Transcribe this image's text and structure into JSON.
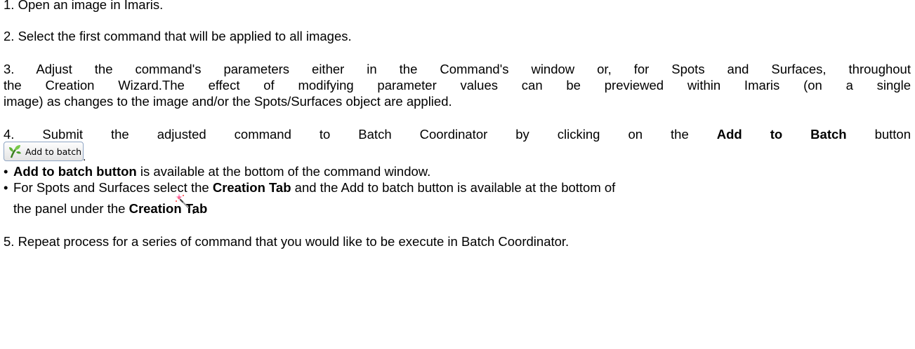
{
  "steps": {
    "s1": "1. Open an image in Imaris.",
    "s2": "2. Select the first command that will be applied to all images.",
    "s3_l1": "3. Adjust the command's parameters either in the Command's window or, for Spots and Surfaces, throughout",
    "s3_l2": "the Creation Wizard.The effect of modifying parameter values can be previewed within Imaris (on a single",
    "s3_l3": "image) as changes to the image and/or the Spots/Surfaces object are applied.",
    "s4_pre": "4. Submit the adjusted command to Batch Coordinator by clicking on the",
    "s4_bold": "Add to Batch",
    "s4_post": "button",
    "s4_period": ".",
    "s5": "5. Repeat process for a series of command that you would like to be execute in Batch Coordinator."
  },
  "button": {
    "label": "Add to batch",
    "icon": "plant-sprout-icon"
  },
  "bullets": {
    "b1_bold": "Add to batch button",
    "b1_rest": " is available at the bottom of the command window.",
    "b2_pre": "For Spots and Surfaces select the ",
    "b2_bold": "Creation Tab",
    "b2_rest": " and the Add to batch button is available at the bottom of",
    "b2_l2_pre": "the  panel under the ",
    "b2_l2_bold": "Creation Tab",
    "b2_l2_icon": "magic-wand-icon",
    "b2_l2_period": "."
  },
  "colors": {
    "button_border": "#8fa6c4",
    "text": "#000000"
  }
}
